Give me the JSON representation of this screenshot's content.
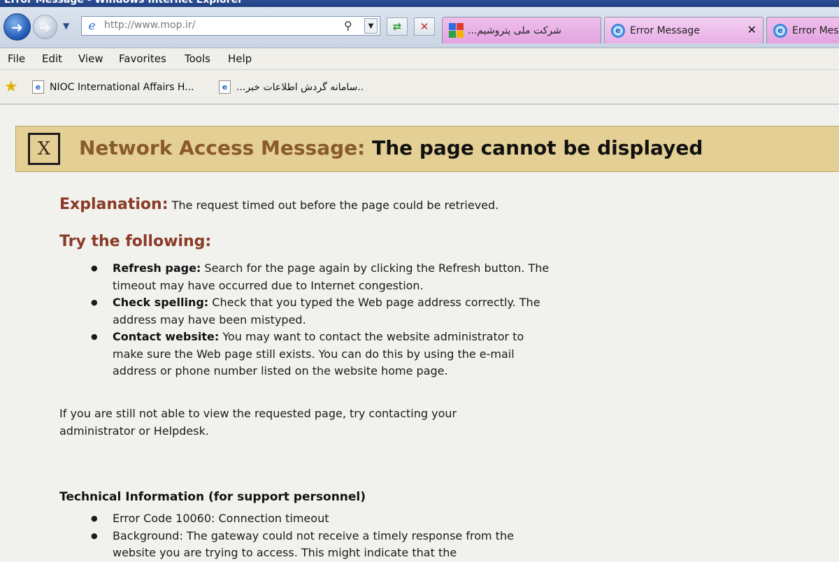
{
  "window": {
    "title": "Error Message - Windows Internet Explorer"
  },
  "address_bar": {
    "url": "http://www.mop.ir/"
  },
  "tabs": [
    {
      "label": "...شرکت ملی پتروشیم",
      "icon": "google-icon"
    },
    {
      "label": "Error Message",
      "icon": "ie-icon",
      "active": true
    },
    {
      "label": "Error Mes",
      "icon": "ie-icon"
    }
  ],
  "menu": [
    "File",
    "Edit",
    "View",
    "Favorites",
    "Tools",
    "Help"
  ],
  "favorites": [
    {
      "label": "NIOC International Affairs H..."
    },
    {
      "label": "...سامانه گردش اطلاعات خبر.."
    }
  ],
  "banner": {
    "icon_text": "X",
    "lead": "Network Access Message:",
    "title": "The page cannot be displayed"
  },
  "explanation": {
    "label": "Explanation:",
    "text": "The request timed out before the page could be retrieved."
  },
  "try_following": {
    "heading": "Try the following:",
    "items": [
      {
        "label": "Refresh page:",
        "text": "Search for the page again by clicking the Refresh button. The timeout may have occurred due to Internet congestion."
      },
      {
        "label": "Check spelling:",
        "text": "Check that you typed the Web page address correctly. The address may have been mistyped."
      },
      {
        "label": "Contact website:",
        "text": "You may want to contact the website administrator to make sure the Web page still exists. You can do this by using the e-mail address or phone number listed on the website home page."
      }
    ]
  },
  "note": "If you are still not able to view the requested page, try contacting your administrator or Helpdesk.",
  "technical": {
    "heading": "Technical Information (for support personnel)",
    "items": [
      "Error Code 10060: Connection timeout",
      "Background: The gateway could not receive a timely response from the website you are trying to access. This might indicate that the"
    ]
  }
}
